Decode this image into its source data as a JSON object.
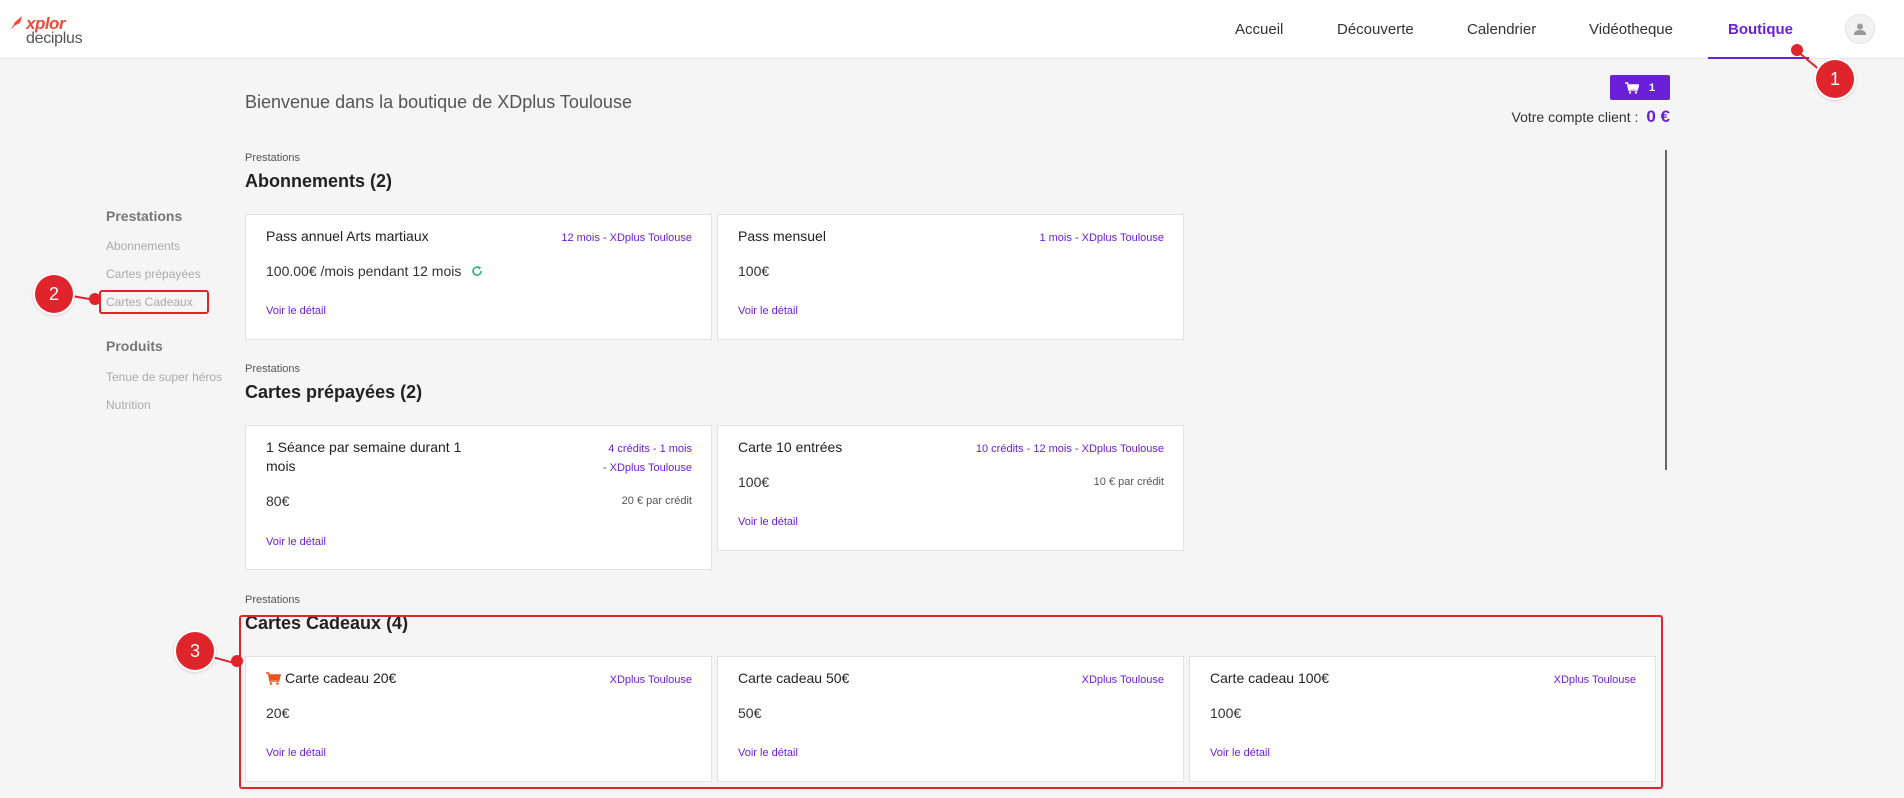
{
  "header": {
    "logo_top": "xplor",
    "logo_bottom": "deciplus",
    "nav": [
      {
        "label": "Accueil"
      },
      {
        "label": "Découverte"
      },
      {
        "label": "Calendrier"
      },
      {
        "label": "Vidéotheque"
      },
      {
        "label": "Boutique",
        "active": true
      }
    ]
  },
  "welcome": {
    "text": "Bienvenue dans la boutique de  XDplus Toulouse"
  },
  "cart": {
    "count": "1"
  },
  "account": {
    "label": "Votre compte client :",
    "amount": "0 €"
  },
  "sidebar": {
    "groups": [
      {
        "heading": "Prestations",
        "items": [
          "Abonnements",
          "Cartes prépayées",
          "Cartes Cadeaux"
        ]
      },
      {
        "heading": "Produits",
        "items": [
          "Tenue de super héros",
          "Nutrition"
        ]
      }
    ]
  },
  "sections": [
    {
      "label": "Prestations",
      "title": "Abonnements (2)",
      "cards": [
        {
          "title": "Pass annuel Arts martiaux",
          "meta": "12 mois   - XDplus Toulouse",
          "price": "100.00€ /mois pendant 12 mois",
          "link": "Voir le détail"
        },
        {
          "title": "Pass mensuel",
          "meta": "1 mois   - XDplus Toulouse",
          "price": "100€",
          "link": "Voir le détail"
        }
      ]
    },
    {
      "label": "Prestations",
      "title": "Cartes prépayées (2)",
      "cards": [
        {
          "title_line1": "1 Séance par semaine durant 1",
          "title_line2": "mois",
          "meta_line1": "4 crédits - 1 mois",
          "meta_line2": "- XDplus Toulouse",
          "price": "80€",
          "percredit": "20 € par crédit",
          "link": "Voir le détail"
        },
        {
          "title": "Carte 10 entrées",
          "meta": "10 crédits - 12 mois   - XDplus Toulouse",
          "price": "100€",
          "percredit": "10 € par crédit",
          "link": "Voir le détail"
        }
      ]
    },
    {
      "label": "Prestations",
      "title": "Cartes Cadeaux (4)",
      "cards": [
        {
          "title": "Carte cadeau 20€",
          "meta": "XDplus Toulouse",
          "price": "20€",
          "link": "Voir le détail"
        },
        {
          "title": "Carte cadeau 50€",
          "meta": "XDplus Toulouse",
          "price": "50€",
          "link": "Voir le détail"
        },
        {
          "title": "Carte cadeau 100€",
          "meta": "XDplus Toulouse",
          "price": "100€",
          "link": "Voir le détail"
        }
      ]
    }
  ],
  "annotations": {
    "one": "1",
    "two": "2",
    "three": "3"
  },
  "colors": {
    "accent": "#6a1fd8",
    "annotation": "#e0242c",
    "brand": "#f04a3a",
    "refresh": "#2bb673",
    "cart_icon": "#e8541f"
  }
}
